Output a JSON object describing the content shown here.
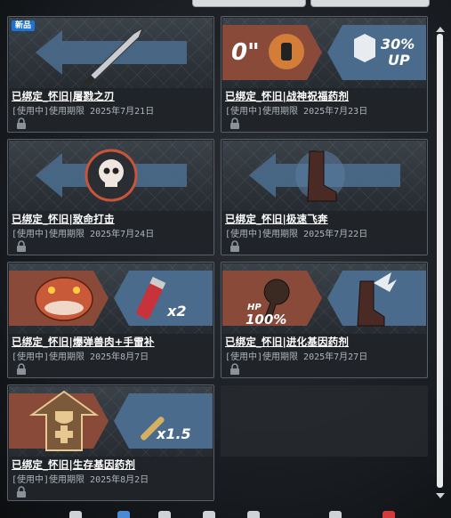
{
  "items": [
    {
      "badge": "新品",
      "title": "已绑定_怀旧|屠戮之刃",
      "expiry": "[使用中]使用期限 2025年7月21日",
      "icon": "combat-knife-icon"
    },
    {
      "title": "已绑定_怀旧|战神祝福药剂",
      "expiry": "[使用中]使用期限 2025年7月23日",
      "icon": "fist-buff-icon",
      "overlay_left": "0\"",
      "overlay_right": "30%",
      "overlay_right_sub": "UP"
    },
    {
      "title": "已绑定_怀旧|致命打击",
      "expiry": "[使用中]使用期限 2025年7月24日",
      "icon": "skull-icon"
    },
    {
      "title": "已绑定_怀旧|极速飞奔",
      "expiry": "[使用中]使用期限 2025年7月22日",
      "icon": "boot-icon"
    },
    {
      "title": "已绑定_怀旧|爆弹兽肉+手雷补",
      "expiry": "[使用中]使用期限 2025年8月7日",
      "icon": "beast-grenade-icon",
      "overlay_right": "x2"
    },
    {
      "title": "已绑定_怀旧|进化基因药剂",
      "expiry": "[使用中]使用期限 2025年7月27日",
      "icon": "hp-boot-icon",
      "overlay_left": "HP",
      "overlay_left_sub": "100%"
    },
    {
      "title": "已绑定_怀旧|生存基因药剂",
      "expiry": "[使用中]使用期限 2025年8月2日",
      "icon": "shield-bullet-icon",
      "overlay_right": "x1.5"
    }
  ],
  "colors": {
    "accent_blue": "#1b74d4",
    "card_border": "#5a6068",
    "arrow_blue": "#4a6b8c",
    "arrow_red": "#8a4a3a"
  }
}
